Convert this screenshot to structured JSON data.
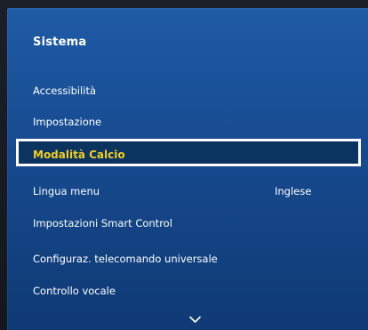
{
  "panel": {
    "title": "Sistema"
  },
  "menu": {
    "items": [
      {
        "label": "Accessibilità"
      },
      {
        "label": "Impostazione"
      },
      {
        "label": "Modalità Calcio",
        "selected": true
      },
      {
        "label": "Lingua menu",
        "value": "Inglese"
      },
      {
        "label": "Impostazioni Smart Control"
      },
      {
        "label": "Configuraz. telecomando universale"
      },
      {
        "label": "Controllo vocale"
      }
    ]
  },
  "colors": {
    "panel_top": "#1f5ba6",
    "panel_bottom": "#0f3a74",
    "selected_bg": "#0b3460",
    "selected_text": "#f3cd22",
    "focus_border": "#ffffff"
  },
  "icons": {
    "scroll_down": "chevron-down-icon"
  }
}
